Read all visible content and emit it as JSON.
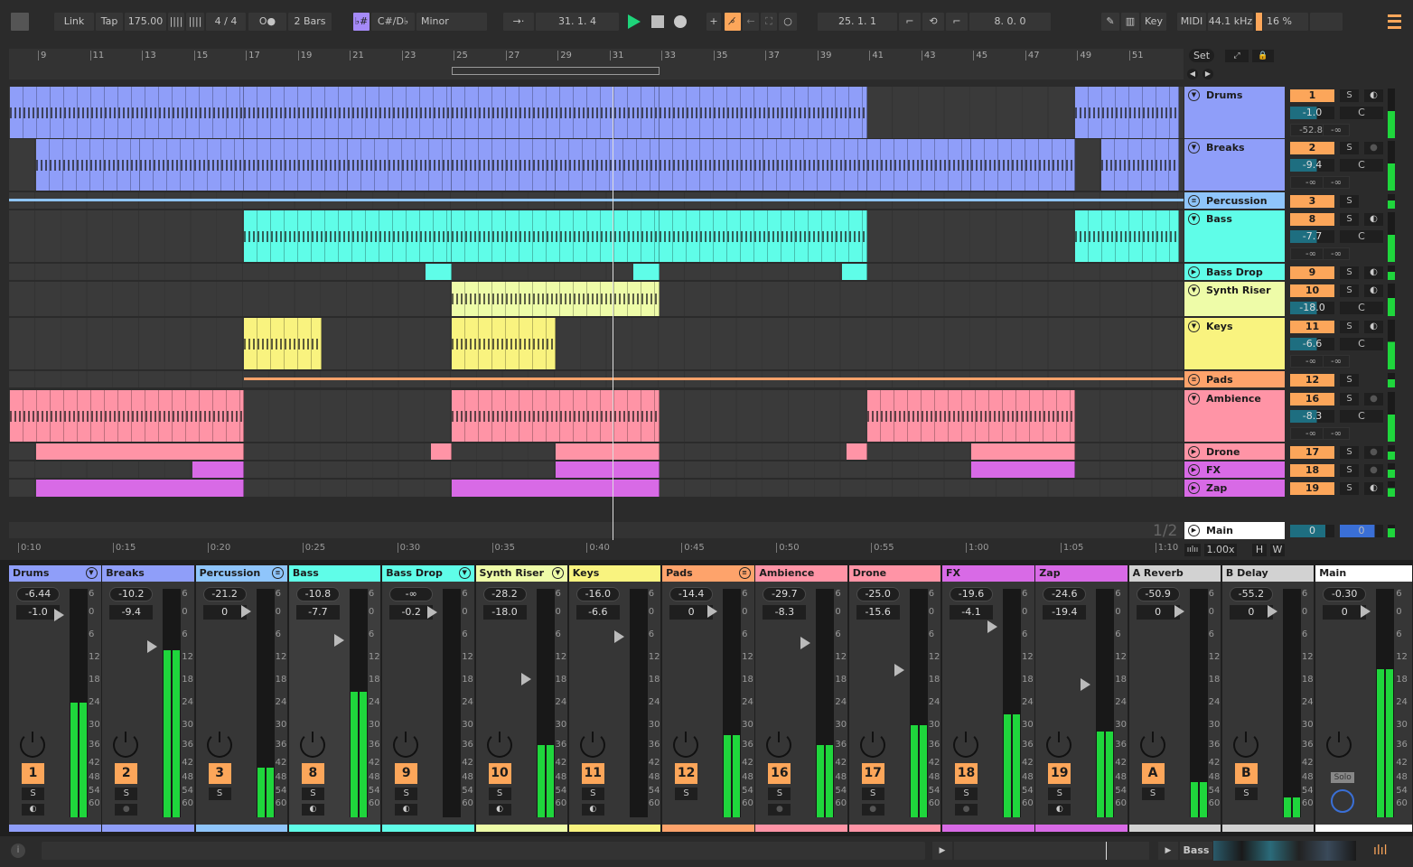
{
  "transport": {
    "link": "Link",
    "tap": "Tap",
    "tempo": "175.00",
    "signature": "4 / 4",
    "quantize": "2 Bars",
    "key": "C#/D♭",
    "scale": "Minor",
    "position": "31.   1.   4",
    "loop_start": "25.   1.   1",
    "loop_length": "8.   0.   0",
    "key_map": "Key",
    "midi_map": "MIDI",
    "sample_rate": "44.1 kHz",
    "cpu": "16 %",
    "cpu_level": 0.16,
    "metronome": "O●"
  },
  "colors": {
    "accent": "#fca65a",
    "play": "#1ed47a",
    "clip_blue": "#8f9ef9",
    "light_blue": "#8fc5fb",
    "cyan": "#5ffde8",
    "pale_yellow": "#eefca8",
    "yellow": "#f9f37f",
    "orange": "#fea36b",
    "pink": "#ff94a6",
    "magenta": "#d86ae6"
  },
  "ruler": {
    "bars": [
      "9",
      "11",
      "13",
      "15",
      "17",
      "19",
      "21",
      "23",
      "25",
      "27",
      "29",
      "31",
      "33",
      "35",
      "37",
      "39",
      "41",
      "43",
      "45",
      "47",
      "49",
      "51"
    ],
    "times": [
      "0:10",
      "0:15",
      "0:20",
      "0:25",
      "0:30",
      "0:35",
      "0:40",
      "0:45",
      "0:50",
      "0:55",
      "1:00",
      "1:05",
      "1:10"
    ],
    "playhead_bar": 31.2,
    "loop": [
      25,
      33
    ]
  },
  "set_button": "Set",
  "page_indicator": "1/2",
  "zoom": {
    "value": "1.00x",
    "h": "H",
    "w": "W"
  },
  "tracks": [
    {
      "name": "Drums",
      "color": "#8f9ef9",
      "icon": "fold",
      "num": "1",
      "vol": "-1.0",
      "pan": "C",
      "send_a": "-52.8",
      "send_b": "-∞",
      "arm": "clock",
      "clips": [
        [
          8,
          17
        ],
        [
          17,
          25
        ],
        [
          25,
          33
        ],
        [
          33,
          41
        ],
        [
          49,
          53
        ]
      ]
    },
    {
      "name": "Breaks",
      "color": "#8f9ef9",
      "icon": "fold",
      "num": "2",
      "vol": "-9.4",
      "pan": "C",
      "send_a": "-∞",
      "send_b": "-∞",
      "arm": "dot",
      "clips": [
        [
          9,
          13
        ],
        [
          13,
          17
        ],
        [
          17,
          21
        ],
        [
          21,
          25
        ],
        [
          25,
          29
        ],
        [
          29,
          33
        ],
        [
          33,
          37
        ],
        [
          37,
          41
        ],
        [
          41,
          45
        ],
        [
          45,
          49
        ],
        [
          50,
          53
        ]
      ]
    },
    {
      "name": "Percussion",
      "color": "#8fc5fb",
      "icon": "group",
      "num": "3",
      "clips": []
    },
    {
      "name": "Bass",
      "color": "#5ffde8",
      "icon": "fold",
      "num": "8",
      "vol": "-7.7",
      "pan": "C",
      "send_a": "-∞",
      "send_b": "-∞",
      "arm": "clock",
      "clips": [
        [
          17,
          25
        ],
        [
          25,
          33
        ],
        [
          33,
          41
        ],
        [
          49,
          53
        ]
      ]
    },
    {
      "name": "Bass Drop",
      "color": "#5ffde8",
      "icon": "play",
      "num": "9",
      "arm": "clock",
      "clips": [
        [
          24,
          25
        ],
        [
          32,
          33
        ],
        [
          40,
          41
        ]
      ]
    },
    {
      "name": "Synth Riser",
      "color": "#eefca8",
      "icon": "fold",
      "num": "10",
      "vol": "-18.0",
      "pan": "C",
      "arm": "clock",
      "clips": [
        [
          25,
          33
        ]
      ]
    },
    {
      "name": "Keys",
      "color": "#f9f37f",
      "icon": "fold",
      "num": "11",
      "vol": "-6.6",
      "pan": "C",
      "send_a": "-∞",
      "send_b": "-∞",
      "arm": "clock",
      "clips": [
        [
          17,
          20
        ],
        [
          25,
          29
        ]
      ]
    },
    {
      "name": "Pads",
      "color": "#fea36b",
      "icon": "group",
      "num": "12",
      "clips": []
    },
    {
      "name": "Ambience",
      "color": "#ff94a6",
      "icon": "fold",
      "num": "16",
      "vol": "-8.3",
      "pan": "C",
      "send_a": "-∞",
      "send_b": "-∞",
      "arm": "dot",
      "clips": [
        [
          8,
          17
        ],
        [
          25,
          33
        ],
        [
          41,
          49
        ]
      ]
    },
    {
      "name": "Drone",
      "color": "#ff94a6",
      "icon": "play",
      "num": "17",
      "arm": "dot",
      "clips": [
        [
          9,
          17
        ],
        [
          24.2,
          25
        ],
        [
          29,
          33
        ],
        [
          40.2,
          41
        ],
        [
          45,
          49
        ]
      ]
    },
    {
      "name": "FX",
      "color": "#d86ae6",
      "icon": "play",
      "num": "18",
      "arm": "dot",
      "clips": [
        [
          15,
          17
        ],
        [
          29,
          33
        ],
        [
          45,
          49
        ]
      ]
    },
    {
      "name": "Zap",
      "color": "#d86ae6",
      "icon": "play",
      "num": "19",
      "arm": "clock",
      "clips": [
        [
          9,
          17
        ],
        [
          25,
          33
        ]
      ]
    }
  ],
  "main_track": {
    "name": "Main",
    "vol": "0",
    "pan": "0"
  },
  "mixer": [
    {
      "name": "Drums",
      "color": "#8f9ef9",
      "peak": "-6.44",
      "vol": "-1.0",
      "num": "1",
      "meter_db": -24,
      "arm": "clock",
      "icon": "fold"
    },
    {
      "name": "Breaks",
      "color": "#8f9ef9",
      "peak": "-10.2",
      "vol": "-9.4",
      "num": "2",
      "meter_db": -10,
      "arm": "dot"
    },
    {
      "name": "Percussion",
      "color": "#8fc5fb",
      "peak": "-21.2",
      "vol": "0",
      "num": "3",
      "meter_db": -44,
      "icon": "group"
    },
    {
      "name": "Bass",
      "color": "#5ffde8",
      "peak": "-10.8",
      "vol": "-7.7",
      "num": "8",
      "meter_db": -21,
      "arm": "clock"
    },
    {
      "name": "Bass Drop",
      "color": "#5ffde8",
      "peak": "-∞",
      "vol": "-0.2",
      "num": "9",
      "meter_db": -99,
      "arm": "clock",
      "icon": "fold"
    },
    {
      "name": "Synth Riser",
      "color": "#eefca8",
      "peak": "-28.2",
      "vol": "-18.0",
      "num": "10",
      "meter_db": -36,
      "arm": "clock",
      "icon": "fold"
    },
    {
      "name": "Keys",
      "color": "#f9f37f",
      "peak": "-16.0",
      "vol": "-6.6",
      "num": "11",
      "meter_db": -62,
      "arm": "clock"
    },
    {
      "name": "Pads",
      "color": "#fea36b",
      "peak": "-14.4",
      "vol": "0",
      "num": "12",
      "meter_db": -33,
      "icon": "group"
    },
    {
      "name": "Ambience",
      "color": "#ff94a6",
      "peak": "-29.7",
      "vol": "-8.3",
      "num": "16",
      "meter_db": -36,
      "arm": "dot"
    },
    {
      "name": "Drone",
      "color": "#ff94a6",
      "peak": "-25.0",
      "vol": "-15.6",
      "num": "17",
      "meter_db": -30,
      "arm": "dot"
    },
    {
      "name": "FX",
      "color": "#d86ae6",
      "peak": "-19.6",
      "vol": "-4.1",
      "num": "18",
      "meter_db": -27,
      "arm": "dot"
    },
    {
      "name": "Zap",
      "color": "#d86ae6",
      "peak": "-24.6",
      "vol": "-19.4",
      "num": "19",
      "meter_db": -32,
      "arm": "clock"
    },
    {
      "name": "A Reverb",
      "color": "#d2d2d2",
      "peak": "-50.9",
      "vol": "0",
      "num": "A",
      "meter_db": -50
    },
    {
      "name": "B Delay",
      "color": "#d2d2d2",
      "peak": "-55.2",
      "vol": "0",
      "num": "B",
      "meter_db": -57
    },
    {
      "name": "Main",
      "color": "#ffffff",
      "peak": "-0.30",
      "vol": "0",
      "solo": "Solo",
      "meter_db": -15
    }
  ],
  "scale_ticks": [
    "6",
    "0",
    "6",
    "12",
    "18",
    "24",
    "30",
    "36",
    "42",
    "48",
    "54",
    "60"
  ],
  "status": {
    "device_track": "Bass"
  }
}
